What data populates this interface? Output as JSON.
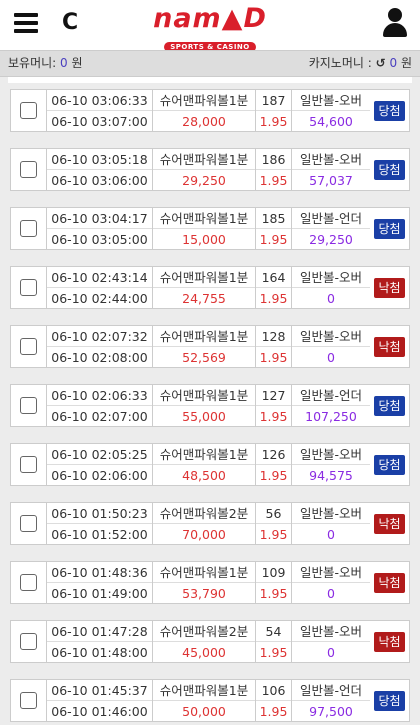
{
  "header": {
    "logo_text": "nam▲D",
    "logo_sub": "SPORTS & CASINO"
  },
  "money": {
    "held_label": "보유머니:",
    "held_value": "0",
    "held_unit": "원",
    "casino_label": "카지노머니 :",
    "casino_value": "0",
    "casino_unit": "원"
  },
  "bets": [
    {
      "bet_time": "06-10 03:06:33",
      "draw_time": "06-10 03:07:00",
      "game": "슈어맨파워볼1분",
      "round": "187",
      "pick": "일반볼-오버",
      "amount": "28,000",
      "odds": "1.95",
      "payout": "54,600",
      "result": "당첨",
      "win": true
    },
    {
      "bet_time": "06-10 03:05:18",
      "draw_time": "06-10 03:06:00",
      "game": "슈어맨파워볼1분",
      "round": "186",
      "pick": "일반볼-오버",
      "amount": "29,250",
      "odds": "1.95",
      "payout": "57,037",
      "result": "당첨",
      "win": true
    },
    {
      "bet_time": "06-10 03:04:17",
      "draw_time": "06-10 03:05:00",
      "game": "슈어맨파워볼1분",
      "round": "185",
      "pick": "일반볼-언더",
      "amount": "15,000",
      "odds": "1.95",
      "payout": "29,250",
      "result": "당첨",
      "win": true
    },
    {
      "bet_time": "06-10 02:43:14",
      "draw_time": "06-10 02:44:00",
      "game": "슈어맨파워볼1분",
      "round": "164",
      "pick": "일반볼-오버",
      "amount": "24,755",
      "odds": "1.95",
      "payout": "0",
      "result": "낙첨",
      "win": false
    },
    {
      "bet_time": "06-10 02:07:32",
      "draw_time": "06-10 02:08:00",
      "game": "슈어맨파워볼1분",
      "round": "128",
      "pick": "일반볼-오버",
      "amount": "52,569",
      "odds": "1.95",
      "payout": "0",
      "result": "낙첨",
      "win": false
    },
    {
      "bet_time": "06-10 02:06:33",
      "draw_time": "06-10 02:07:00",
      "game": "슈어맨파워볼1분",
      "round": "127",
      "pick": "일반볼-언더",
      "amount": "55,000",
      "odds": "1.95",
      "payout": "107,250",
      "result": "당첨",
      "win": true
    },
    {
      "bet_time": "06-10 02:05:25",
      "draw_time": "06-10 02:06:00",
      "game": "슈어맨파워볼1분",
      "round": "126",
      "pick": "일반볼-오버",
      "amount": "48,500",
      "odds": "1.95",
      "payout": "94,575",
      "result": "당첨",
      "win": true
    },
    {
      "bet_time": "06-10 01:50:23",
      "draw_time": "06-10 01:52:00",
      "game": "슈어맨파워볼2분",
      "round": "56",
      "pick": "일반볼-오버",
      "amount": "70,000",
      "odds": "1.95",
      "payout": "0",
      "result": "낙첨",
      "win": false
    },
    {
      "bet_time": "06-10 01:48:36",
      "draw_time": "06-10 01:49:00",
      "game": "슈어맨파워볼1분",
      "round": "109",
      "pick": "일반볼-오버",
      "amount": "53,790",
      "odds": "1.95",
      "payout": "0",
      "result": "낙첨",
      "win": false
    },
    {
      "bet_time": "06-10 01:47:28",
      "draw_time": "06-10 01:48:00",
      "game": "슈어맨파워볼2분",
      "round": "54",
      "pick": "일반볼-오버",
      "amount": "45,000",
      "odds": "1.95",
      "payout": "0",
      "result": "낙첨",
      "win": false
    },
    {
      "bet_time": "06-10 01:45:37",
      "draw_time": "06-10 01:46:00",
      "game": "슈어맨파워볼1분",
      "round": "106",
      "pick": "일반볼-언더",
      "amount": "50,000",
      "odds": "1.95",
      "payout": "97,500",
      "result": "당첨",
      "win": true
    }
  ]
}
